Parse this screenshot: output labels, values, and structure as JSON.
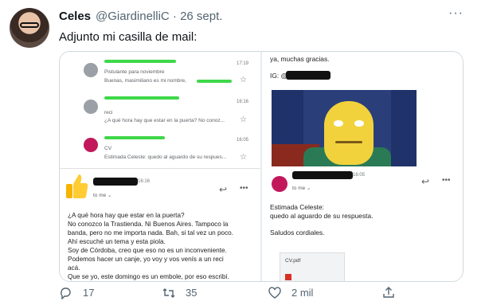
{
  "tweet": {
    "author_name": "Celes",
    "author_handle": "@GiardinelliC · 26 sept.",
    "more_label": "···",
    "text": "Adjunto mi casilla de mail:"
  },
  "left_panel": {
    "inbox": [
      {
        "time": "17:19",
        "subject": "Pistulante para noviembre",
        "snippet": "Buenas, masimiliano es mi nombre,",
        "avatar_color": "#9aa0a6"
      },
      {
        "time": "16:16",
        "subject": "reci",
        "snippet": "¿A qué hora hay que estar en la puerta? No conoz...",
        "avatar_color": "#9aa0a6"
      },
      {
        "time": "16:05",
        "subject": "CV",
        "snippet": "Estimada Celeste: quedo al aguardo de su respues...",
        "avatar_color": "#c2185b"
      }
    ],
    "open_mail": {
      "time": "16:16",
      "to": "to me ⌄",
      "body": [
        "¿A qué hora hay que estar en la puerta?",
        "No conozco la Trastienda. Ni Buenos Aires. Tampoco la",
        "banda, pero no me importa nada. Bah, si tal vez un poco.",
        "Ahí escuché un tema y esta piola.",
        "Soy de Córdoba, creo que eso no es un inconveniente.",
        "Podemos hacer un canje, yo voy y vos venís a un reci",
        "acá.",
        "Que se yo, este domingo es un embole, por eso escribí."
      ]
    }
  },
  "right_panel": {
    "top_line": "ya, muchas gracias.",
    "ig_label": "IG: @",
    "mail_time": "16:05",
    "to": "to me ⌄",
    "greeting": "Estimada Celeste:",
    "line1": "quedo al aguardo de su respuesta.",
    "closing": "Saludos cordiales.",
    "attachment": "CV.pdf"
  },
  "actions": {
    "replies": "17",
    "retweets": "35",
    "likes": "2 mil"
  },
  "colors": {
    "accent_green": "#3fd84a",
    "text_secondary": "#536471"
  }
}
